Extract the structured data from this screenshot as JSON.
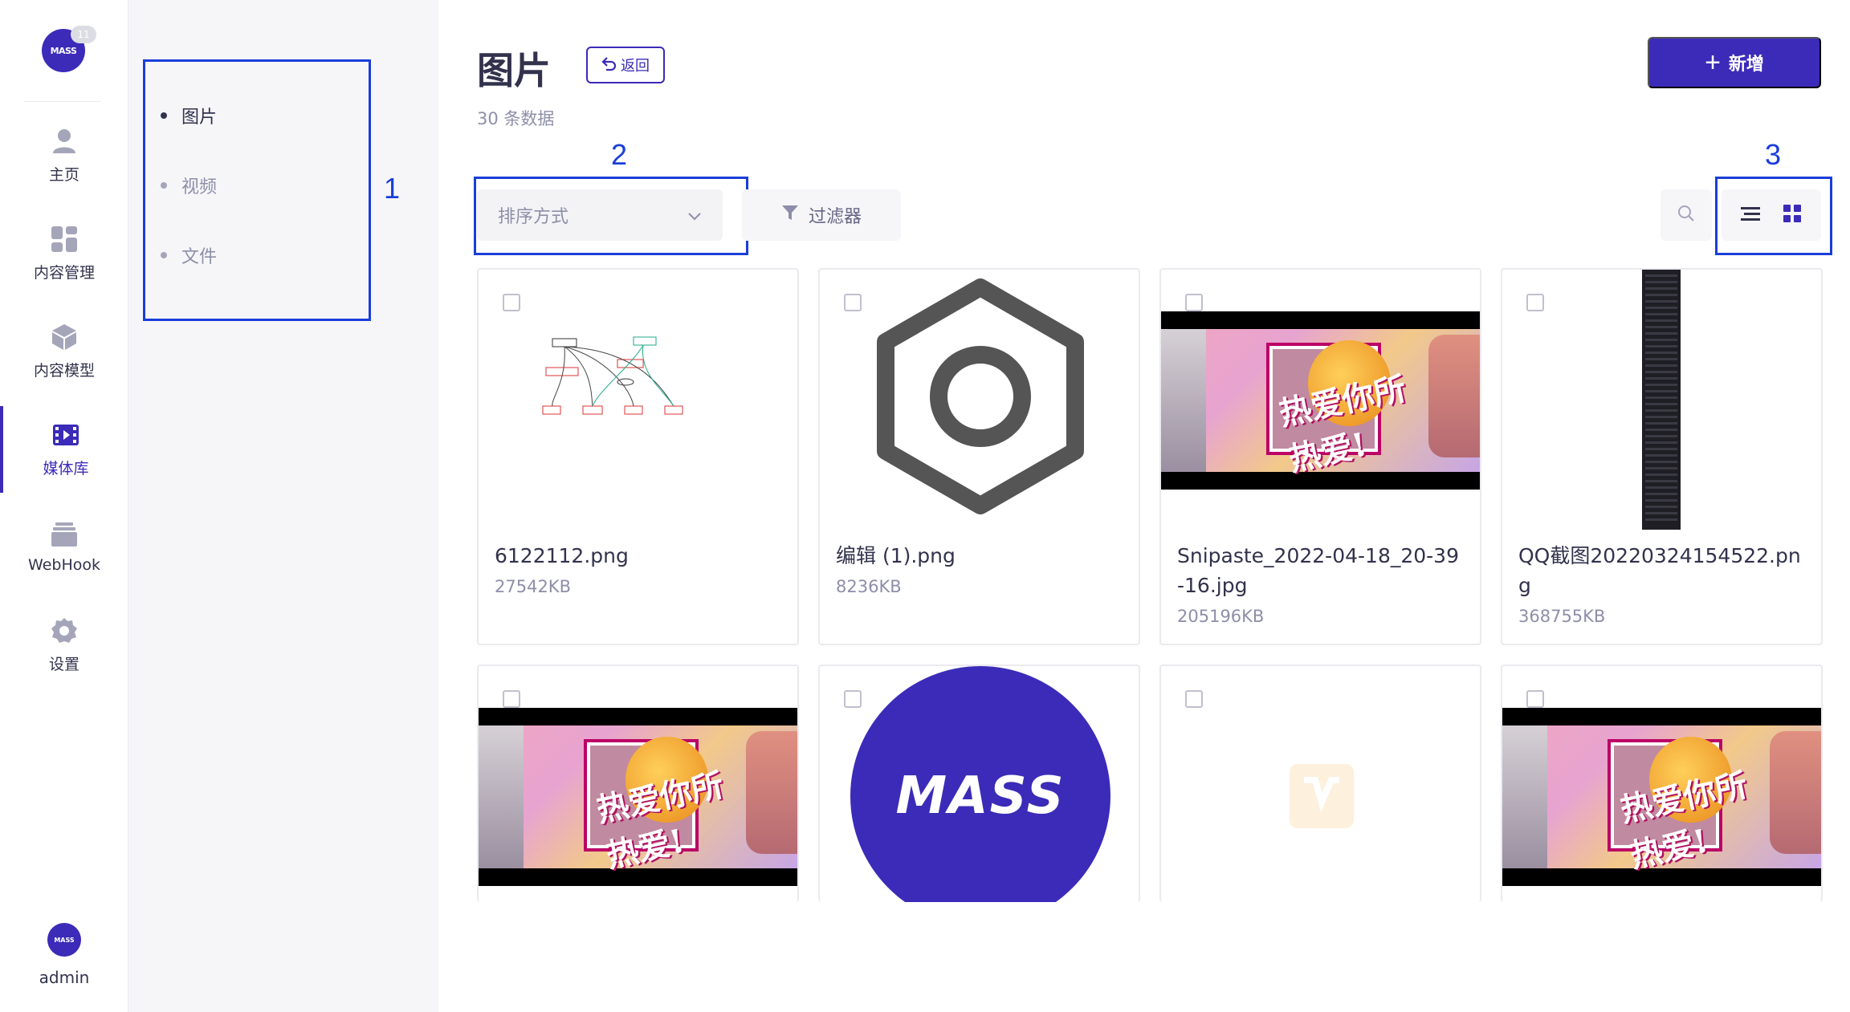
{
  "app": {
    "logo_text": "MASS",
    "logo_badge": "11",
    "user": "admin"
  },
  "nav": {
    "items": [
      {
        "label": "主页",
        "icon": "user-icon"
      },
      {
        "label": "内容管理",
        "icon": "grid-icon"
      },
      {
        "label": "内容模型",
        "icon": "cube-icon"
      },
      {
        "label": "媒体库",
        "icon": "film-icon"
      },
      {
        "label": "WebHook",
        "icon": "tray-icon"
      },
      {
        "label": "设置",
        "icon": "gear-icon"
      }
    ],
    "active": "媒体库"
  },
  "subnav": {
    "items": [
      "图片",
      "视频",
      "文件"
    ],
    "active": "图片"
  },
  "annotations": [
    "1",
    "2",
    "3"
  ],
  "header": {
    "title": "图片",
    "back_label": "返回",
    "count_text": "30 条数据",
    "add_label": "新增"
  },
  "toolbar": {
    "sort_placeholder": "排序方式",
    "filter_label": "过滤器"
  },
  "cards": [
    {
      "name": "6122112.png",
      "size": "27542KB",
      "thumb": "diagram"
    },
    {
      "name": "编辑 (1).png",
      "size": "8236KB",
      "thumb": "hex-icon"
    },
    {
      "name": "Snipaste_2022-04-18_20-39-16.jpg",
      "size": "205196KB",
      "thumb": "poster"
    },
    {
      "name": "QQ截图20220324154522.png",
      "size": "368755KB",
      "thumb": "screenshot"
    },
    {
      "name": "",
      "size": "",
      "thumb": "poster"
    },
    {
      "name": "",
      "size": "",
      "thumb": "mass-logo"
    },
    {
      "name": "",
      "size": "",
      "thumb": "v1-logo"
    },
    {
      "name": "",
      "size": "",
      "thumb": "poster"
    }
  ],
  "colors": {
    "accent": "#3b2bb8",
    "annotation": "#1a3ed9",
    "muted": "#8e8ea9"
  }
}
